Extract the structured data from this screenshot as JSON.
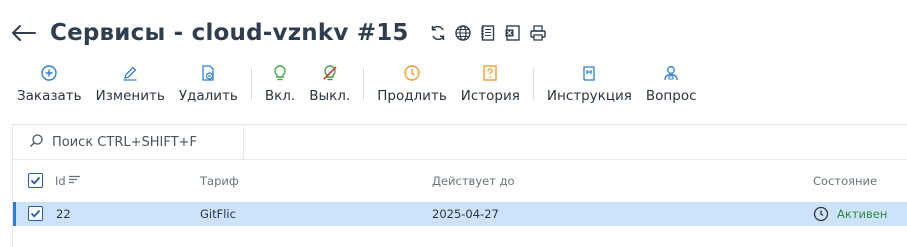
{
  "header": {
    "title": "Сервисы - cloud-vznkv #15",
    "icons": [
      "refresh-icon",
      "globe-icon",
      "notes-icon",
      "excel-icon",
      "print-icon"
    ]
  },
  "toolbar": {
    "order": "Заказать",
    "edit": "Изменить",
    "delete": "Удалить",
    "enable": "Вкл.",
    "disable": "Выкл.",
    "extend": "Продлить",
    "history": "История",
    "manual": "Инструкция",
    "question": "Вопрос"
  },
  "colors": {
    "accent": "#2d7fd4",
    "enable_icon": "#3aa040",
    "disable_icon": "#d33a2f",
    "history_icon": "#f0a030",
    "selected_row": "#cde3fb",
    "status_active": "#2f8a3c"
  },
  "search": {
    "placeholder": "Поиск CTRL+SHIFT+F"
  },
  "table": {
    "columns": {
      "id": "Id",
      "tariff": "Тариф",
      "valid_until": "Действует до",
      "status": "Состояние"
    },
    "rows": [
      {
        "id": "22",
        "tariff": "GitFlic",
        "valid_until": "2025-04-27",
        "status": "Активен",
        "selected": true
      }
    ]
  }
}
